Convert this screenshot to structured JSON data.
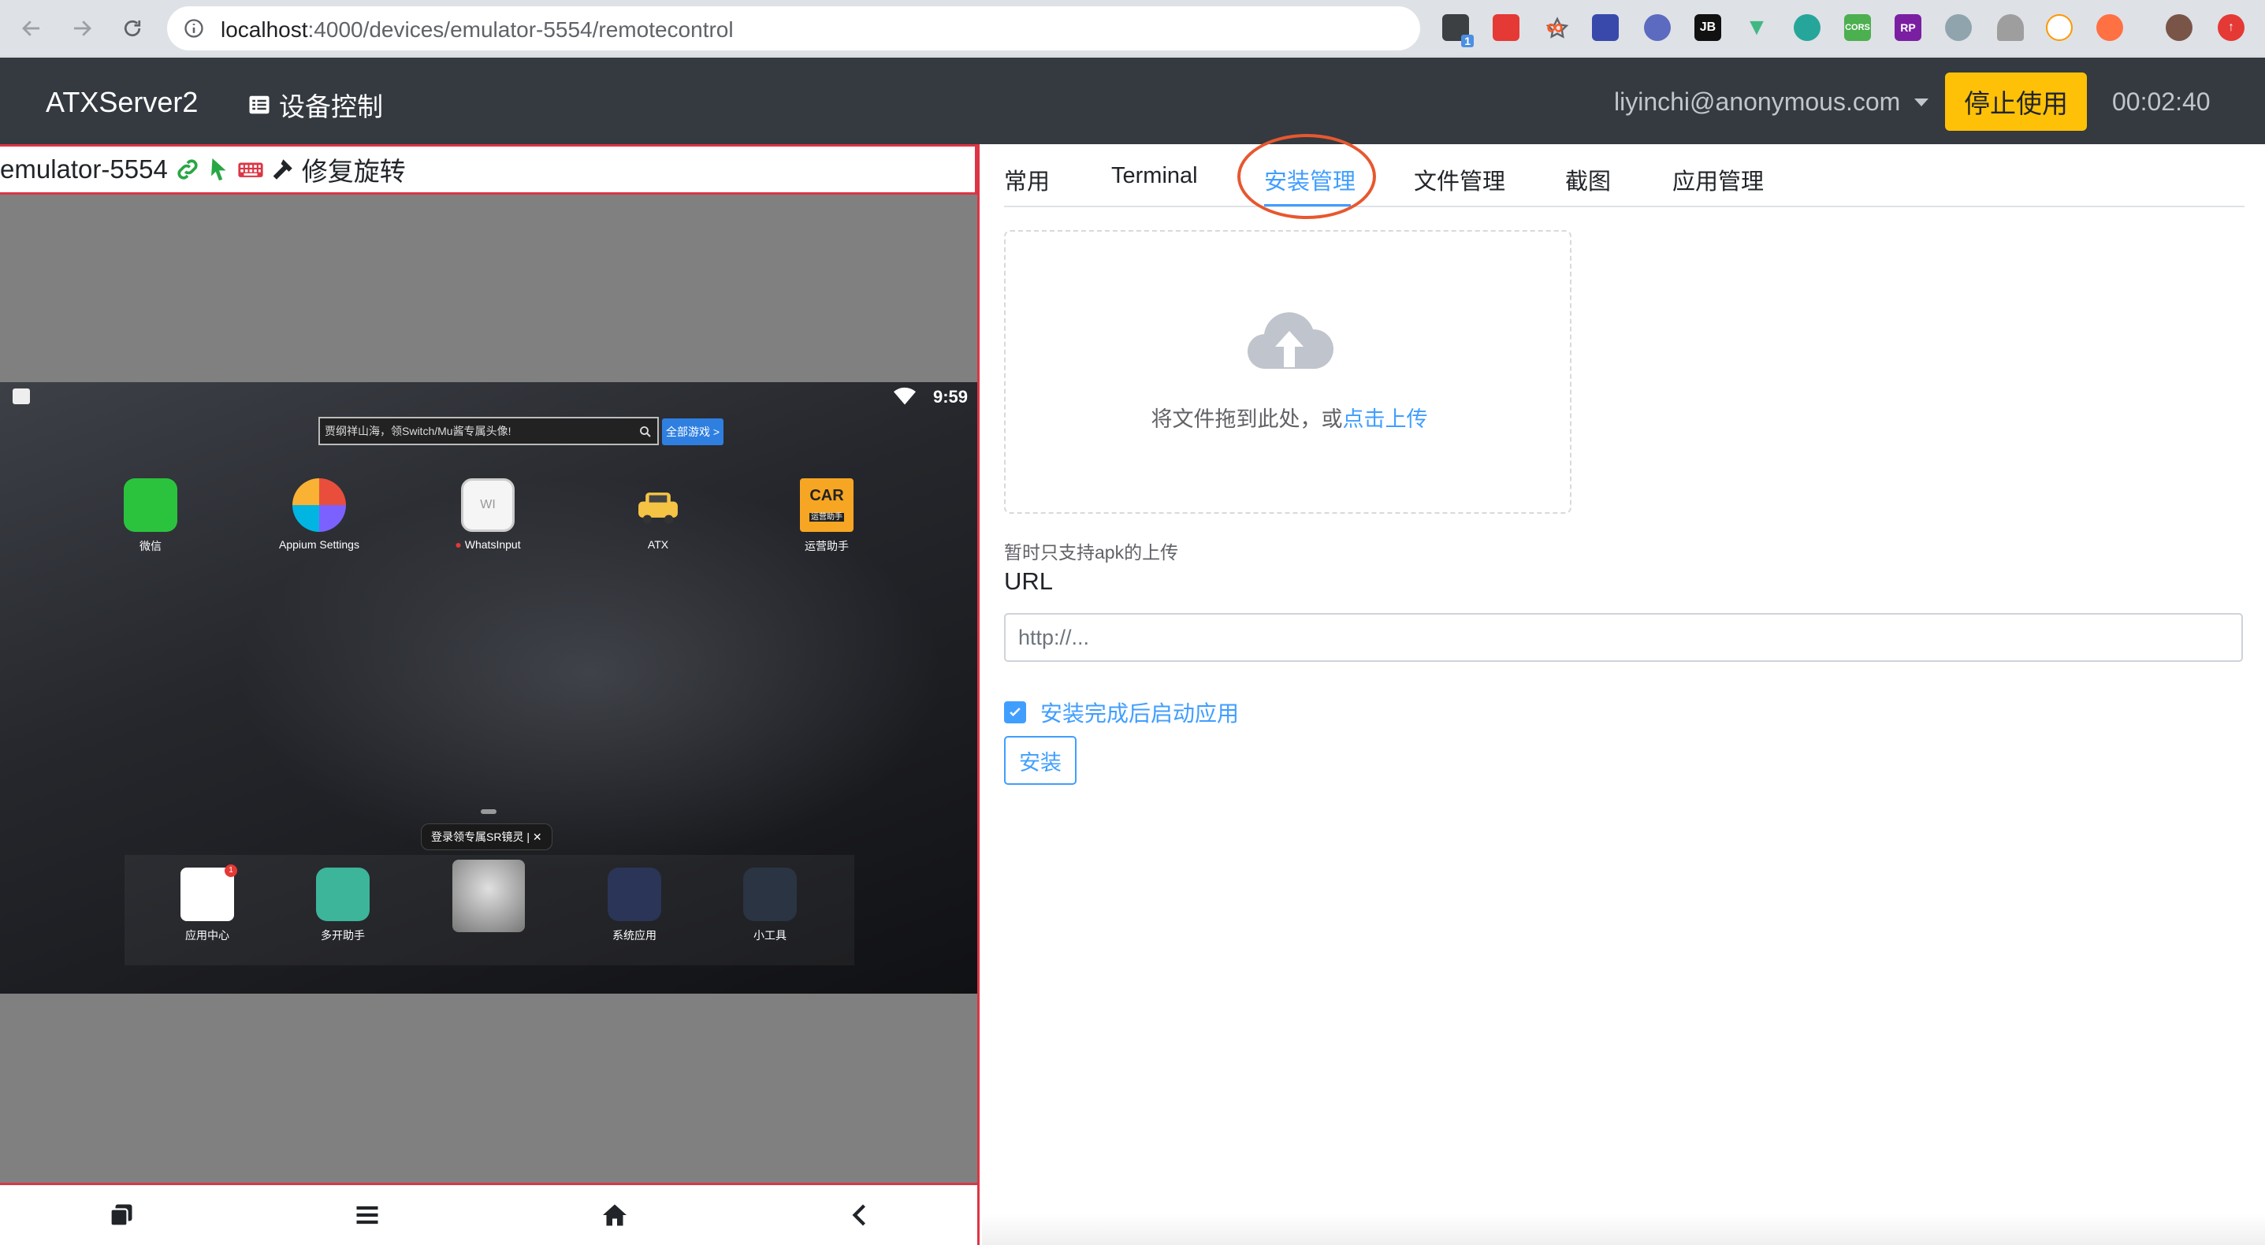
{
  "browser": {
    "url_host": "localhost",
    "url_path": ":4000/devices/emulator-5554/remotecontrol"
  },
  "navbar": {
    "brand": "ATXServer2",
    "device_control": "设备控制",
    "user": "liyinchi@anonymous.com",
    "stop_label": "停止使用",
    "timer": "00:02:40"
  },
  "device": {
    "name": "emulator-5554",
    "fix_rotation": "修复旋转",
    "status_time": "9:59",
    "search_placeholder": "贾纲祥山海，领Switch/Mu酱专属头像!",
    "search_button": "全部游戏 >",
    "apps": [
      "微信",
      "Appium Settings",
      "WhatsInput",
      "ATX",
      "运营助手"
    ],
    "dock_apps": [
      "应用中心",
      "多开助手",
      "系统应用",
      "小工具"
    ],
    "tooltip": "登录领专属SR镜灵 | ✕",
    "app_badge": "1",
    "whats_icon_text": "WI",
    "car_icon_text": "CAR",
    "car_icon_sub": "运营助手"
  },
  "tabs": [
    "常用",
    "Terminal",
    "安装管理",
    "文件管理",
    "截图",
    "应用管理"
  ],
  "upload": {
    "prompt": "将文件拖到此处，或",
    "link": "点击上传",
    "tip": "暂时只支持apk的上传"
  },
  "install": {
    "url_label": "URL",
    "url_placeholder": "http://...",
    "launch_label": "安装完成后启动应用",
    "install_button": "安装"
  },
  "extensions": {
    "badge": "1",
    "jb": "JB",
    "cors": "CORS",
    "rp": "RP"
  },
  "colors": {
    "navbar": "#343a40",
    "warning": "#ffc107",
    "accent": "#409eff",
    "danger": "#dc3545"
  }
}
